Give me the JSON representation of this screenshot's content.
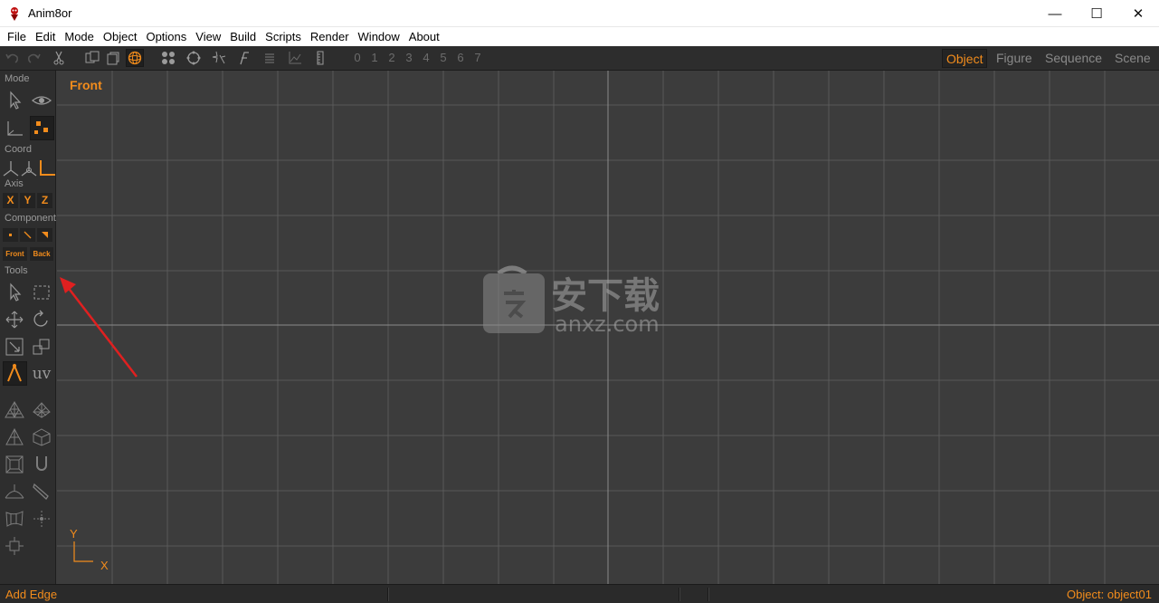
{
  "window": {
    "title": "Anim8or",
    "minimize_glyph": "—",
    "maximize_glyph": "☐",
    "close_glyph": "✕"
  },
  "menu": [
    "File",
    "Edit",
    "Mode",
    "Object",
    "Options",
    "View",
    "Build",
    "Scripts",
    "Render",
    "Window",
    "About"
  ],
  "toolbar": {
    "icons": [
      "undo-icon",
      "redo-icon",
      "cut-icon",
      "copy-icon",
      "paste-icon",
      "sphere-icon",
      "arrange-icon",
      "rotate-icon",
      "sparkle-icon",
      "function-icon",
      "text-icon",
      "graph-icon",
      "ruler-icon"
    ],
    "numbers": [
      "0",
      "1",
      "2",
      "3",
      "4",
      "5",
      "6",
      "7"
    ],
    "mode_tabs": [
      "Object",
      "Figure",
      "Sequence",
      "Scene"
    ],
    "active_tab": "Object"
  },
  "left_panel": {
    "mode_label": "Mode",
    "coord_label": "Coord",
    "axis_label": "Axis",
    "axis_buttons": [
      "X",
      "Y",
      "Z"
    ],
    "component_label": "Component",
    "front_label": "Front",
    "back_label": "Back",
    "tools_label": "Tools",
    "uv_label": "uv"
  },
  "viewport": {
    "label": "Front",
    "axis_y": "Y",
    "axis_x": "X",
    "watermark": "安下载 anxz.com"
  },
  "status": {
    "left": "Add Edge",
    "right": "Object: object01"
  },
  "colors": {
    "accent": "#f28c1c",
    "viewport_bg": "#3c3c3c",
    "grid": "#5a5a5a",
    "arrow": "#e02020"
  }
}
